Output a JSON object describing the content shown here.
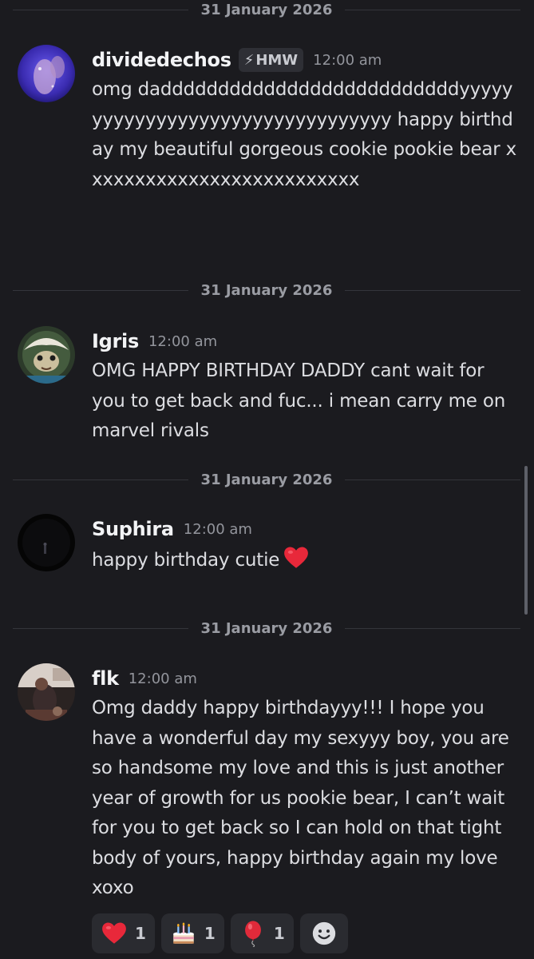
{
  "colors": {
    "background": "#1b1b1f",
    "username": "#f2f3f5",
    "text": "#dcdde1",
    "muted": "#93959c",
    "divider": "#34353b",
    "reaction_bg": "#2a2b30",
    "heart": "#e8283a"
  },
  "messages": [
    {
      "date": "31 January 2026",
      "username": "dividedechos",
      "tag": "HMW",
      "tag_icon": "lightning-icon",
      "time": "12:00 am",
      "text": "omg daddddddddddddddddddddddddddyyyyyyyyyyyyyyyyyyyyyyyyyyyyyyyyy happy birthday my beautiful gorgeous cookie pookie bear xxxxxxxxxxxxxxxxxxxxxxxxxx",
      "avatar": "avatar-image"
    },
    {
      "date": "31 January 2026",
      "username": "Igris",
      "time": "12:00 am",
      "text": "OMG HAPPY BIRTHDAY DADDY cant wait for you to get back and fuc... i mean carry me on marvel rivals",
      "avatar": "avatar-image"
    },
    {
      "date": "31 January 2026",
      "username": "Suphira",
      "time": "12:00 am",
      "text": "happy birthday cutie",
      "emoji": "red-heart-icon",
      "avatar": "avatar-image"
    },
    {
      "date": "31 January 2026",
      "username": "flk",
      "time": "12:00 am",
      "text": "Omg daddy happy birthdayyy!!! I hope you have a wonderful day my sexyyy boy, you are so handsome my love and this is just another year of growth for us pookie bear, I can’t wait for you to get back so I can hold on that tight body of yours, happy birthday again my love xoxo",
      "avatar": "avatar-image"
    }
  ],
  "reactions": [
    {
      "emoji": "red-heart-icon",
      "count": "1"
    },
    {
      "emoji": "birthday-cake-icon",
      "count": "1"
    },
    {
      "emoji": "balloon-icon",
      "count": "1"
    }
  ],
  "add_reaction_icon": "add-reaction-smiley-icon"
}
